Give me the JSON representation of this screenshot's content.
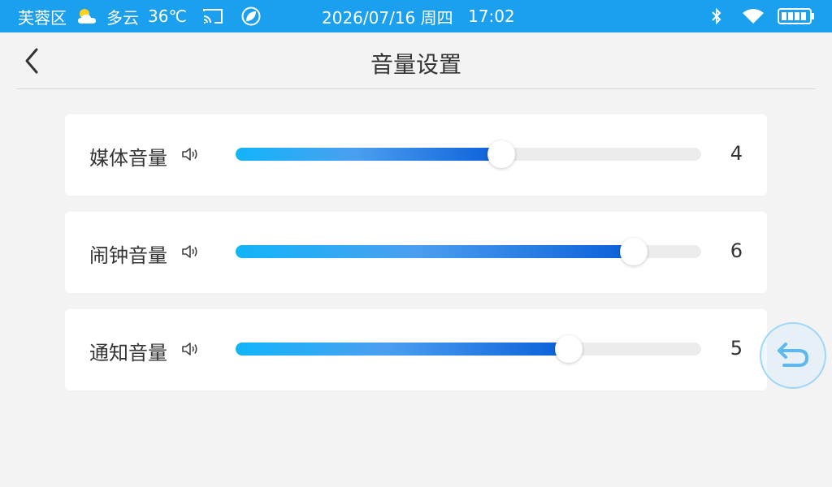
{
  "status_bar": {
    "location": "芙蓉区",
    "weather": "多云",
    "temperature": "36℃",
    "datetime": "2026/07/16 周四",
    "time": "17:02",
    "icons": [
      "partly-cloudy-icon",
      "cast-icon",
      "leaf-icon",
      "bluetooth-icon",
      "wifi-icon",
      "battery-icon"
    ]
  },
  "header": {
    "title": "音量设置",
    "back_icon": "chevron-left-icon"
  },
  "volumes": [
    {
      "label": "媒体音量",
      "value": "4",
      "level_percent": 57
    },
    {
      "label": "闹钟音量",
      "value": "6",
      "level_percent": 85.5
    },
    {
      "label": "通知音量",
      "value": "5",
      "level_percent": 71.5
    }
  ],
  "floating_button": {
    "icon": "return-arrow-icon"
  },
  "colors": {
    "status_bar": "#1aa0ee",
    "background": "#f3f3f3",
    "slider_start": "#12b4f8",
    "slider_end": "#0a5fd8",
    "track": "#ececec",
    "float_border": "#9fd7f7"
  }
}
